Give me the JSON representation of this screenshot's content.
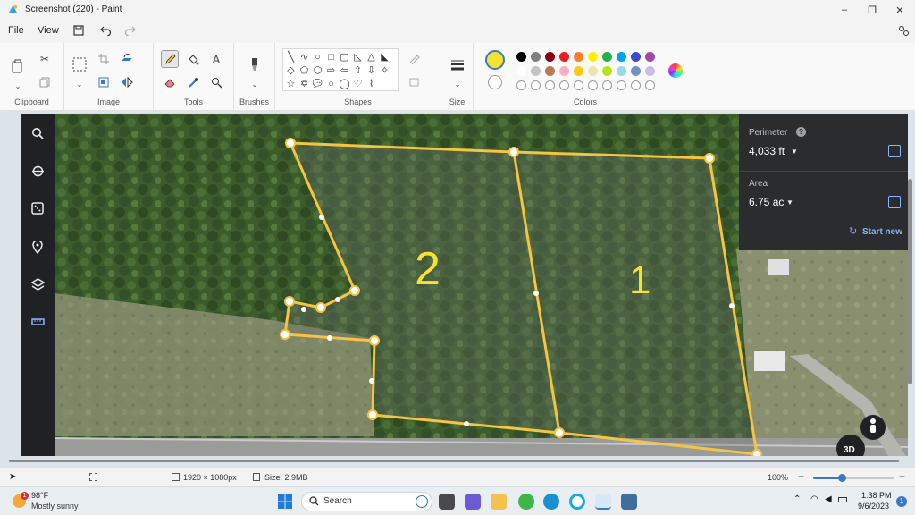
{
  "window": {
    "title": "Screenshot (220) - Paint",
    "minimize": "–",
    "maximize": "❐",
    "close": "✕"
  },
  "menu": {
    "file": "File",
    "view": "View"
  },
  "ribbon": {
    "groups": {
      "clipboard": "Clipboard",
      "image": "Image",
      "tools": "Tools",
      "brushes": "Brushes",
      "shapes": "Shapes",
      "size": "Size",
      "colors": "Colors"
    },
    "text_tool": "A",
    "shape_glyphs": [
      "╲",
      "∿",
      "○",
      "□",
      "▢",
      "◺",
      "△",
      "◣",
      "◇",
      "⬠",
      "⬡",
      "⇨",
      "⇦",
      "⇧",
      "⇩",
      "✧",
      "☆",
      "✡",
      "💬",
      "○",
      "◯",
      "♡",
      "⌇"
    ],
    "primary_color": "#f8e231",
    "secondary_color": "#ffffff",
    "palette_row1": [
      "#000000",
      "#7f7f7f",
      "#880015",
      "#ed1c24",
      "#ff7f27",
      "#fff200",
      "#22b14c",
      "#00a2e8",
      "#3f48cc",
      "#a349a4"
    ],
    "palette_row2": [
      "#ffffff",
      "#c3c3c3",
      "#b97a57",
      "#ffaec9",
      "#ffc90e",
      "#efe4b0",
      "#b5e61d",
      "#99d9ea",
      "#7092be",
      "#c8bfe7"
    ]
  },
  "map": {
    "perimeter_label": "Perimeter",
    "perimeter_value": "4,033 ft",
    "area_label": "Area",
    "area_value": "6.75 ac",
    "start_new": "Start new",
    "lot_1": "1",
    "lot_2": "2",
    "view_3d": "3D",
    "outline_color": "#f6c342"
  },
  "status": {
    "dimensions": "1920 × 1080px",
    "size": "Size: 2.9MB",
    "zoom": "100%"
  },
  "taskbar": {
    "temperature": "98°F",
    "weather": "Mostly sunny",
    "weather_badge": "1",
    "search_placeholder": "Search",
    "time": "1:38 PM",
    "date": "9/6/2023",
    "notification_count": "1"
  }
}
